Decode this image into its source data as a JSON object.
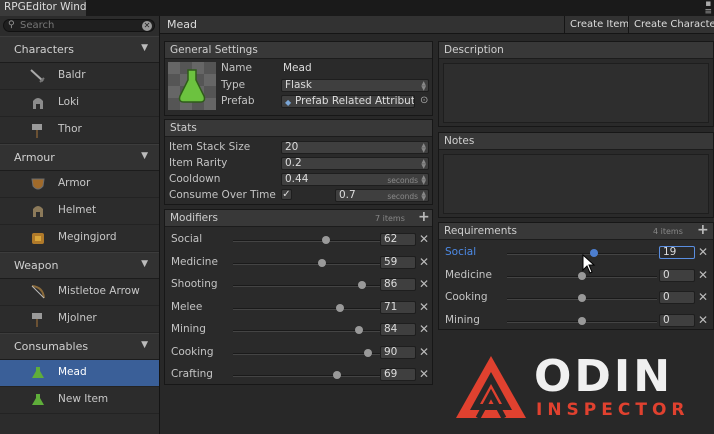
{
  "window": {
    "tab_title": "RPGEditor Wind"
  },
  "search": {
    "placeholder": "Search"
  },
  "sidebar": {
    "categories": [
      {
        "label": "Characters",
        "items": [
          {
            "label": "Baldr",
            "icon": "sword-icon"
          },
          {
            "label": "Loki",
            "icon": "helmet-icon"
          },
          {
            "label": "Thor",
            "icon": "hammer-icon"
          }
        ]
      },
      {
        "label": "Armour",
        "items": [
          {
            "label": "Armor",
            "icon": "shield-icon"
          },
          {
            "label": "Helmet",
            "icon": "helmet-icon"
          },
          {
            "label": "Megingjord",
            "icon": "belt-icon"
          }
        ]
      },
      {
        "label": "Weapon",
        "items": [
          {
            "label": "Mistletoe Arrow",
            "icon": "bow-icon"
          },
          {
            "label": "Mjolner",
            "icon": "hammer-icon"
          }
        ]
      },
      {
        "label": "Consumables",
        "items": [
          {
            "label": "Mead",
            "icon": "flask-icon",
            "selected": true
          },
          {
            "label": "New Item",
            "icon": "flask-icon"
          }
        ]
      }
    ]
  },
  "toolbar": {
    "item_title": "Mead",
    "create_item": "Create Item",
    "create_character": "Create Character"
  },
  "general": {
    "header": "General Settings",
    "name_label": "Name",
    "name_value": "Mead",
    "type_label": "Type",
    "type_value": "Flask",
    "prefab_label": "Prefab",
    "prefab_value": "Prefab Related Attribute"
  },
  "stats": {
    "header": "Stats",
    "stack_label": "Item Stack Size",
    "stack_value": "20",
    "rarity_label": "Item Rarity",
    "rarity_value": "0.2",
    "cooldown_label": "Cooldown",
    "cooldown_value": "0.44",
    "cooldown_unit": "seconds",
    "consume_label": "Consume Over Time",
    "consume_checked": true,
    "consume_value": "0.7",
    "consume_unit": "seconds"
  },
  "modifiers": {
    "header": "Modifiers",
    "count": "7 items",
    "rows": [
      {
        "name": "Social",
        "value": "62",
        "fill": 0.62
      },
      {
        "name": "Medicine",
        "value": "59",
        "fill": 0.59
      },
      {
        "name": "Shooting",
        "value": "86",
        "fill": 0.86
      },
      {
        "name": "Melee",
        "value": "71",
        "fill": 0.71
      },
      {
        "name": "Mining",
        "value": "84",
        "fill": 0.84
      },
      {
        "name": "Cooking",
        "value": "90",
        "fill": 0.9
      },
      {
        "name": "Crafting",
        "value": "69",
        "fill": 0.69
      }
    ]
  },
  "description": {
    "header": "Description"
  },
  "notes": {
    "header": "Notes"
  },
  "requirements": {
    "header": "Requirements",
    "count": "4 items",
    "rows": [
      {
        "name": "Social",
        "value": "19",
        "fill": 0.58,
        "active": true
      },
      {
        "name": "Medicine",
        "value": "0",
        "fill": 0.5
      },
      {
        "name": "Cooking",
        "value": "0",
        "fill": 0.5
      },
      {
        "name": "Mining",
        "value": "0",
        "fill": 0.5
      }
    ]
  },
  "logo": {
    "word": "ODIN",
    "sub": "INSPECTOR"
  },
  "colors": {
    "selection": "#3a5f98",
    "active_text": "#4d8ae6",
    "logo_red": "#e0412f"
  }
}
